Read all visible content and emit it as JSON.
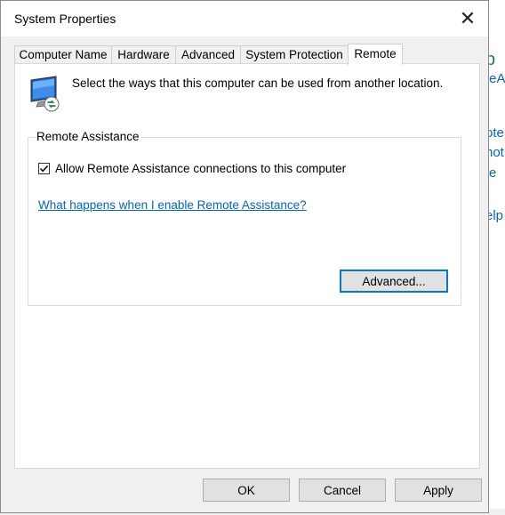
{
  "dialog": {
    "title": "System Properties",
    "close_glyph": "✕"
  },
  "tabs": [
    {
      "label": "Computer Name"
    },
    {
      "label": "Hardware"
    },
    {
      "label": "Advanced"
    },
    {
      "label": "System Protection"
    },
    {
      "label": "Remote",
      "active": true
    }
  ],
  "remote": {
    "intro": "Select the ways that this computer can be used from another location.",
    "group_title": "Remote Assistance",
    "allow_label": "Allow Remote Assistance connections to this computer",
    "allow_checked": true,
    "help_link": "What happens when I enable Remote Assistance?",
    "advanced_button": "Advanced..."
  },
  "buttons": {
    "ok": "OK",
    "cancel": "Cancel",
    "apply": "Apply"
  },
  "background_fragments": {
    "f1": "p",
    "f2": "teA",
    "f3": "ote",
    "f4": "not",
    "f5": "e",
    "f6": "elp"
  },
  "colors": {
    "link": "#0066cc",
    "accent": "#0078d7",
    "green_text": "#1a7f37"
  }
}
